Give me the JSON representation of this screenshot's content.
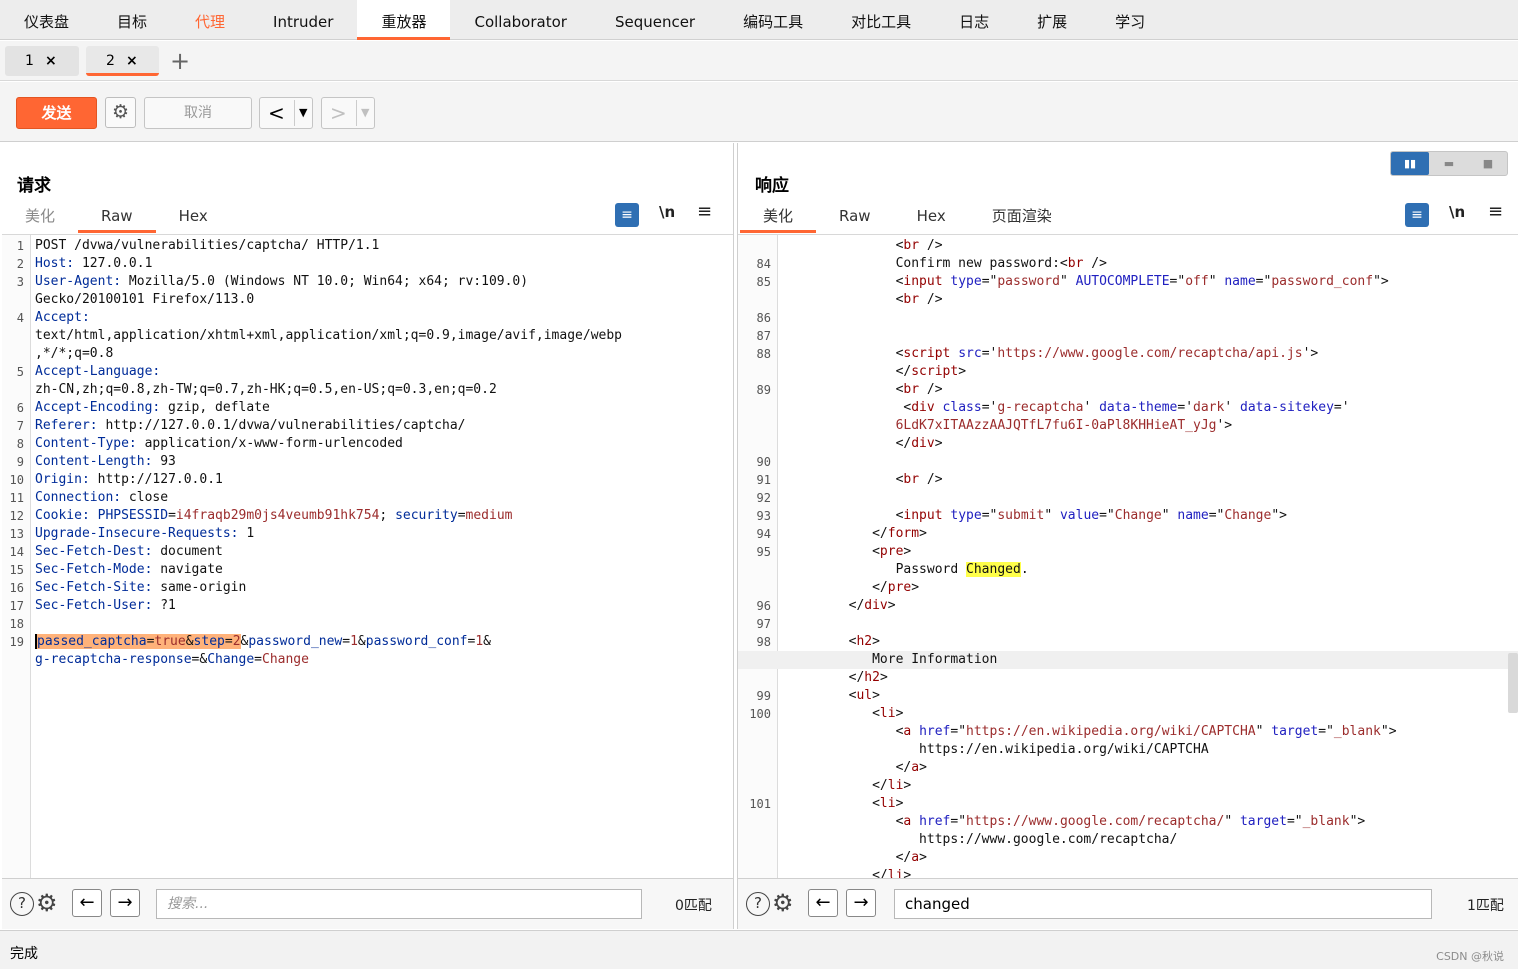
{
  "topnav": [
    "仪表盘",
    "目标",
    "代理",
    "Intruder",
    "重放器",
    "Collaborator",
    "Sequencer",
    "编码工具",
    "对比工具",
    "日志",
    "扩展",
    "学习"
  ],
  "tabs": [
    {
      "num": "1",
      "close": "×"
    },
    {
      "num": "2",
      "close": "×"
    }
  ],
  "add_tab": "+",
  "toolbar": {
    "send": "发送",
    "cancel": "取消",
    "back_arrow": "<",
    "fwd_arrow": ">",
    "dropdown": "▼"
  },
  "request": {
    "title": "请求",
    "subtabs": [
      "美化",
      "Raw",
      "Hex"
    ],
    "newline_toggle": "\\n",
    "search_placeholder": "搜索...",
    "match_count": "0匹配"
  },
  "response": {
    "title": "响应",
    "subtabs": [
      "美化",
      "Raw",
      "Hex",
      "页面渲染"
    ],
    "newline_toggle": "\\n",
    "search_value": "changed",
    "match_count": "1匹配"
  },
  "request_lines": [
    {
      "no": "1",
      "segs": [
        {
          "t": "POST /dvwa/vulnerabilities/captcha/ HTTP/1.1",
          "c": "v"
        }
      ]
    },
    {
      "no": "2",
      "segs": [
        {
          "t": "Host:",
          "c": "k"
        },
        {
          "t": " 127.0.0.1",
          "c": "v"
        }
      ]
    },
    {
      "no": "3",
      "segs": [
        {
          "t": "User-Agent:",
          "c": "k"
        },
        {
          "t": " Mozilla/5.0 (Windows NT 10.0; Win64; x64; rv:109.0)",
          "c": "v"
        }
      ]
    },
    {
      "no": "",
      "segs": [
        {
          "t": "Gecko/20100101 Firefox/113.0",
          "c": "v"
        }
      ]
    },
    {
      "no": "4",
      "segs": [
        {
          "t": "Accept:",
          "c": "k"
        }
      ]
    },
    {
      "no": "",
      "segs": [
        {
          "t": "text/html,application/xhtml+xml,application/xml;q=0.9,image/avif,image/webp",
          "c": "v"
        }
      ]
    },
    {
      "no": "",
      "segs": [
        {
          "t": ",*/*;q=0.8",
          "c": "v"
        }
      ]
    },
    {
      "no": "5",
      "segs": [
        {
          "t": "Accept-Language:",
          "c": "k"
        }
      ]
    },
    {
      "no": "",
      "segs": [
        {
          "t": "zh-CN,zh;q=0.8,zh-TW;q=0.7,zh-HK;q=0.5,en-US;q=0.3,en;q=0.2",
          "c": "v"
        }
      ]
    },
    {
      "no": "6",
      "segs": [
        {
          "t": "Accept-Encoding:",
          "c": "k"
        },
        {
          "t": " gzip, deflate",
          "c": "v"
        }
      ]
    },
    {
      "no": "7",
      "segs": [
        {
          "t": "Referer:",
          "c": "k"
        },
        {
          "t": " http://127.0.0.1/dvwa/vulnerabilities/captcha/",
          "c": "v"
        }
      ]
    },
    {
      "no": "8",
      "segs": [
        {
          "t": "Content-Type:",
          "c": "k"
        },
        {
          "t": " application/x-www-form-urlencoded",
          "c": "v"
        }
      ]
    },
    {
      "no": "9",
      "segs": [
        {
          "t": "Content-Length:",
          "c": "k"
        },
        {
          "t": " 93",
          "c": "v"
        }
      ]
    },
    {
      "no": "10",
      "segs": [
        {
          "t": "Origin:",
          "c": "k"
        },
        {
          "t": " http://127.0.0.1",
          "c": "v"
        }
      ]
    },
    {
      "no": "11",
      "segs": [
        {
          "t": "Connection:",
          "c": "k"
        },
        {
          "t": " close",
          "c": "v"
        }
      ]
    },
    {
      "no": "12",
      "segs": [
        {
          "t": "Cookie:",
          "c": "k"
        },
        {
          "t": " ",
          "c": "v"
        },
        {
          "t": "PHPSESSID",
          "c": "k"
        },
        {
          "t": "=",
          "c": "v"
        },
        {
          "t": "i4fraqb29m0js4veumb91hk754",
          "c": "str"
        },
        {
          "t": "; ",
          "c": "v"
        },
        {
          "t": "security",
          "c": "k"
        },
        {
          "t": "=",
          "c": "v"
        },
        {
          "t": "medium",
          "c": "str"
        }
      ]
    },
    {
      "no": "13",
      "segs": [
        {
          "t": "Upgrade-Insecure-Requests:",
          "c": "k"
        },
        {
          "t": " 1",
          "c": "v"
        }
      ]
    },
    {
      "no": "14",
      "segs": [
        {
          "t": "Sec-Fetch-Dest:",
          "c": "k"
        },
        {
          "t": " document",
          "c": "v"
        }
      ]
    },
    {
      "no": "15",
      "segs": [
        {
          "t": "Sec-Fetch-Mode:",
          "c": "k"
        },
        {
          "t": " navigate",
          "c": "v"
        }
      ]
    },
    {
      "no": "16",
      "segs": [
        {
          "t": "Sec-Fetch-Site:",
          "c": "k"
        },
        {
          "t": " same-origin",
          "c": "v"
        }
      ]
    },
    {
      "no": "17",
      "segs": [
        {
          "t": "Sec-Fetch-User:",
          "c": "k"
        },
        {
          "t": " ?1",
          "c": "v"
        }
      ]
    },
    {
      "no": "18",
      "segs": []
    },
    {
      "no": "19",
      "segs": [
        {
          "t": "passed_captcha",
          "c": "k hlsel caret"
        },
        {
          "t": "=",
          "c": "v hlsel"
        },
        {
          "t": "true",
          "c": "str hlsel"
        },
        {
          "t": "&",
          "c": "v hlsel"
        },
        {
          "t": "step",
          "c": "k hlsel"
        },
        {
          "t": "=",
          "c": "v hlsel"
        },
        {
          "t": "2",
          "c": "str hlsel"
        },
        {
          "t": "&",
          "c": "v"
        },
        {
          "t": "password_new",
          "c": "k"
        },
        {
          "t": "=",
          "c": "v"
        },
        {
          "t": "1",
          "c": "str"
        },
        {
          "t": "&",
          "c": "v"
        },
        {
          "t": "password_conf",
          "c": "k"
        },
        {
          "t": "=",
          "c": "v"
        },
        {
          "t": "1",
          "c": "str"
        },
        {
          "t": "&",
          "c": "v"
        }
      ]
    },
    {
      "no": "",
      "segs": [
        {
          "t": "g-recaptcha-response",
          "c": "k"
        },
        {
          "t": "=&",
          "c": "v"
        },
        {
          "t": "Change",
          "c": "k"
        },
        {
          "t": "=",
          "c": "v"
        },
        {
          "t": "Change",
          "c": "str"
        }
      ]
    }
  ],
  "response_lines": [
    {
      "no": "",
      "segs": [
        {
          "t": "              <",
          "c": "v"
        },
        {
          "t": "br",
          "c": "tag"
        },
        {
          "t": " />",
          "c": "v"
        }
      ]
    },
    {
      "no": "84",
      "segs": [
        {
          "t": "              Confirm new password:<",
          "c": "v"
        },
        {
          "t": "br",
          "c": "tag"
        },
        {
          "t": " />",
          "c": "v"
        }
      ]
    },
    {
      "no": "85",
      "segs": [
        {
          "t": "              <",
          "c": "v"
        },
        {
          "t": "input",
          "c": "tag"
        },
        {
          "t": " ",
          "c": "v"
        },
        {
          "t": "type",
          "c": "attr"
        },
        {
          "t": "=\"",
          "c": "v"
        },
        {
          "t": "password",
          "c": "str"
        },
        {
          "t": "\" ",
          "c": "v"
        },
        {
          "t": "AUTOCOMPLETE",
          "c": "attr"
        },
        {
          "t": "=\"",
          "c": "v"
        },
        {
          "t": "off",
          "c": "str"
        },
        {
          "t": "\" ",
          "c": "v"
        },
        {
          "t": "name",
          "c": "attr"
        },
        {
          "t": "=\"",
          "c": "v"
        },
        {
          "t": "password_conf",
          "c": "str"
        },
        {
          "t": "\">",
          "c": "v"
        }
      ]
    },
    {
      "no": "",
      "segs": [
        {
          "t": "              <",
          "c": "v"
        },
        {
          "t": "br",
          "c": "tag"
        },
        {
          "t": " />",
          "c": "v"
        }
      ]
    },
    {
      "no": "86",
      "segs": []
    },
    {
      "no": "87",
      "segs": []
    },
    {
      "no": "88",
      "segs": [
        {
          "t": "              <",
          "c": "v"
        },
        {
          "t": "script",
          "c": "tag"
        },
        {
          "t": " ",
          "c": "v"
        },
        {
          "t": "src",
          "c": "attr"
        },
        {
          "t": "='",
          "c": "v"
        },
        {
          "t": "https://www.google.com/recaptcha/api.js",
          "c": "str"
        },
        {
          "t": "'>",
          "c": "v"
        }
      ]
    },
    {
      "no": "",
      "segs": [
        {
          "t": "              </",
          "c": "v"
        },
        {
          "t": "script",
          "c": "tag"
        },
        {
          "t": ">",
          "c": "v"
        }
      ]
    },
    {
      "no": "89",
      "segs": [
        {
          "t": "              <",
          "c": "v"
        },
        {
          "t": "br",
          "c": "tag"
        },
        {
          "t": " />",
          "c": "v"
        }
      ]
    },
    {
      "no": "",
      "segs": [
        {
          "t": "               <",
          "c": "v"
        },
        {
          "t": "div",
          "c": "tag"
        },
        {
          "t": " ",
          "c": "v"
        },
        {
          "t": "class",
          "c": "attr"
        },
        {
          "t": "='",
          "c": "v"
        },
        {
          "t": "g-recaptcha",
          "c": "str"
        },
        {
          "t": "' ",
          "c": "v"
        },
        {
          "t": "data-theme",
          "c": "attr"
        },
        {
          "t": "='",
          "c": "v"
        },
        {
          "t": "dark",
          "c": "str"
        },
        {
          "t": "' ",
          "c": "v"
        },
        {
          "t": "data-sitekey",
          "c": "attr"
        },
        {
          "t": "='",
          "c": "v"
        }
      ]
    },
    {
      "no": "",
      "segs": [
        {
          "t": "              ",
          "c": "v"
        },
        {
          "t": "6LdK7xITAAzzAAJQTfL7fu6I-0aPl8KHHieAT_yJg",
          "c": "str"
        },
        {
          "t": "'>",
          "c": "v"
        }
      ]
    },
    {
      "no": "",
      "segs": [
        {
          "t": "              </",
          "c": "v"
        },
        {
          "t": "div",
          "c": "tag"
        },
        {
          "t": ">",
          "c": "v"
        }
      ]
    },
    {
      "no": "90",
      "segs": []
    },
    {
      "no": "91",
      "segs": [
        {
          "t": "              <",
          "c": "v"
        },
        {
          "t": "br",
          "c": "tag"
        },
        {
          "t": " />",
          "c": "v"
        }
      ]
    },
    {
      "no": "92",
      "segs": []
    },
    {
      "no": "93",
      "segs": [
        {
          "t": "              <",
          "c": "v"
        },
        {
          "t": "input",
          "c": "tag"
        },
        {
          "t": " ",
          "c": "v"
        },
        {
          "t": "type",
          "c": "attr"
        },
        {
          "t": "=\"",
          "c": "v"
        },
        {
          "t": "submit",
          "c": "str"
        },
        {
          "t": "\" ",
          "c": "v"
        },
        {
          "t": "value",
          "c": "attr"
        },
        {
          "t": "=\"",
          "c": "v"
        },
        {
          "t": "Change",
          "c": "str"
        },
        {
          "t": "\" ",
          "c": "v"
        },
        {
          "t": "name",
          "c": "attr"
        },
        {
          "t": "=\"",
          "c": "v"
        },
        {
          "t": "Change",
          "c": "str"
        },
        {
          "t": "\">",
          "c": "v"
        }
      ]
    },
    {
      "no": "94",
      "segs": [
        {
          "t": "           </",
          "c": "v"
        },
        {
          "t": "form",
          "c": "tag"
        },
        {
          "t": ">",
          "c": "v"
        }
      ]
    },
    {
      "no": "95",
      "segs": [
        {
          "t": "           <",
          "c": "v"
        },
        {
          "t": "pre",
          "c": "tag"
        },
        {
          "t": ">",
          "c": "v"
        }
      ]
    },
    {
      "no": "",
      "segs": [
        {
          "t": "              Password ",
          "c": "v"
        },
        {
          "t": "Changed",
          "c": "v yel"
        },
        {
          "t": ".",
          "c": "v"
        }
      ]
    },
    {
      "no": "",
      "segs": [
        {
          "t": "           </",
          "c": "v"
        },
        {
          "t": "pre",
          "c": "tag"
        },
        {
          "t": ">",
          "c": "v"
        }
      ]
    },
    {
      "no": "96",
      "segs": [
        {
          "t": "        </",
          "c": "v"
        },
        {
          "t": "div",
          "c": "tag"
        },
        {
          "t": ">",
          "c": "v"
        }
      ]
    },
    {
      "no": "97",
      "segs": []
    },
    {
      "no": "98",
      "segs": [
        {
          "t": "        <",
          "c": "v"
        },
        {
          "t": "h2",
          "c": "tag"
        },
        {
          "t": ">",
          "c": "v"
        }
      ]
    },
    {
      "no": "",
      "segs": [
        {
          "t": "           More Information",
          "c": "v"
        }
      ],
      "cur": true
    },
    {
      "no": "",
      "segs": [
        {
          "t": "        </",
          "c": "v"
        },
        {
          "t": "h2",
          "c": "tag"
        },
        {
          "t": ">",
          "c": "v"
        }
      ]
    },
    {
      "no": "99",
      "segs": [
        {
          "t": "        <",
          "c": "v"
        },
        {
          "t": "ul",
          "c": "tag"
        },
        {
          "t": ">",
          "c": "v"
        }
      ]
    },
    {
      "no": "100",
      "segs": [
        {
          "t": "           <",
          "c": "v"
        },
        {
          "t": "li",
          "c": "tag"
        },
        {
          "t": ">",
          "c": "v"
        }
      ]
    },
    {
      "no": "",
      "segs": [
        {
          "t": "              <",
          "c": "v"
        },
        {
          "t": "a",
          "c": "tag"
        },
        {
          "t": " ",
          "c": "v"
        },
        {
          "t": "href",
          "c": "attr"
        },
        {
          "t": "=\"",
          "c": "v"
        },
        {
          "t": "https://en.wikipedia.org/wiki/CAPTCHA",
          "c": "str"
        },
        {
          "t": "\" ",
          "c": "v"
        },
        {
          "t": "target",
          "c": "attr"
        },
        {
          "t": "=\"",
          "c": "v"
        },
        {
          "t": "_blank",
          "c": "str"
        },
        {
          "t": "\">",
          "c": "v"
        }
      ]
    },
    {
      "no": "",
      "segs": [
        {
          "t": "                 https://en.wikipedia.org/wiki/CAPTCHA",
          "c": "v"
        }
      ]
    },
    {
      "no": "",
      "segs": [
        {
          "t": "              </",
          "c": "v"
        },
        {
          "t": "a",
          "c": "tag"
        },
        {
          "t": ">",
          "c": "v"
        }
      ]
    },
    {
      "no": "",
      "segs": [
        {
          "t": "           </",
          "c": "v"
        },
        {
          "t": "li",
          "c": "tag"
        },
        {
          "t": ">",
          "c": "v"
        }
      ]
    },
    {
      "no": "101",
      "segs": [
        {
          "t": "           <",
          "c": "v"
        },
        {
          "t": "li",
          "c": "tag"
        },
        {
          "t": ">",
          "c": "v"
        }
      ]
    },
    {
      "no": "",
      "segs": [
        {
          "t": "              <",
          "c": "v"
        },
        {
          "t": "a",
          "c": "tag"
        },
        {
          "t": " ",
          "c": "v"
        },
        {
          "t": "href",
          "c": "attr"
        },
        {
          "t": "=\"",
          "c": "v"
        },
        {
          "t": "https://www.google.com/recaptcha/",
          "c": "str"
        },
        {
          "t": "\" ",
          "c": "v"
        },
        {
          "t": "target",
          "c": "attr"
        },
        {
          "t": "=\"",
          "c": "v"
        },
        {
          "t": "_blank",
          "c": "str"
        },
        {
          "t": "\">",
          "c": "v"
        }
      ]
    },
    {
      "no": "",
      "segs": [
        {
          "t": "                 https://www.google.com/recaptcha/",
          "c": "v"
        }
      ]
    },
    {
      "no": "",
      "segs": [
        {
          "t": "              </",
          "c": "v"
        },
        {
          "t": "a",
          "c": "tag"
        },
        {
          "t": ">",
          "c": "v"
        }
      ]
    },
    {
      "no": "",
      "segs": [
        {
          "t": "           </",
          "c": "v"
        },
        {
          "t": "li",
          "c": "tag"
        },
        {
          "t": ">",
          "c": "v"
        }
      ]
    }
  ],
  "status": {
    "text": "完成",
    "watermark": "CSDN @秋说"
  },
  "colors": {
    "accent": "#ff6633",
    "blue": "#2f6fb3",
    "highlight": "#ffff4a"
  }
}
